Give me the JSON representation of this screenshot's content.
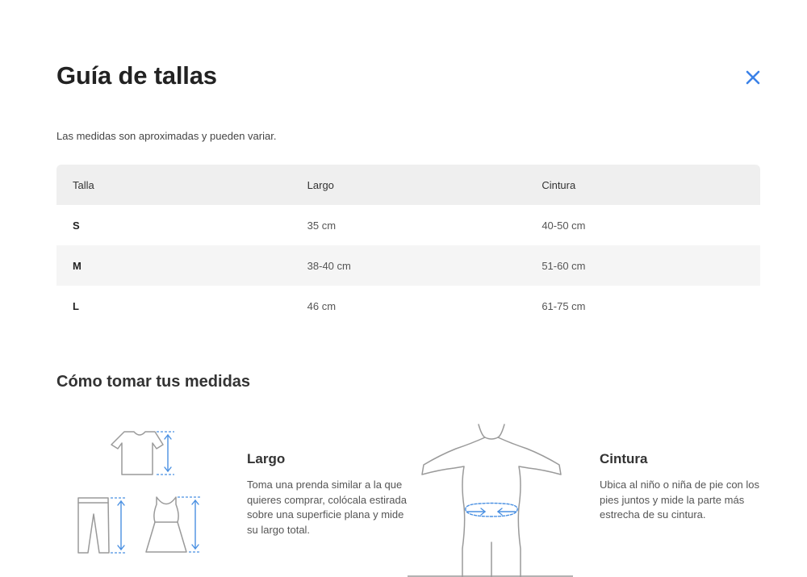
{
  "header": {
    "title": "Guía de tallas",
    "close_icon": "close-icon"
  },
  "intro": "Las medidas son aproximadas y pueden variar.",
  "table": {
    "columns": [
      "Talla",
      "Largo",
      "Cintura"
    ],
    "rows": [
      [
        "S",
        "35 cm",
        "40-50 cm"
      ],
      [
        "M",
        "38-40 cm",
        "51-60 cm"
      ],
      [
        "L",
        "46 cm",
        "61-75 cm"
      ]
    ]
  },
  "howto": {
    "title": "Cómo tomar tus medidas",
    "length": {
      "title": "Largo",
      "text": "Toma una prenda similar a la que quieres comprar, colócala estirada sobre una superficie plana y mide su largo total.",
      "illustration": "garments-length-illustration"
    },
    "waist": {
      "title": "Cintura",
      "text": "Ubica al niño o niña de pie con los pies juntos y mide la parte más estrecha de su cintura.",
      "illustration": "body-waist-illustration"
    }
  },
  "colors": {
    "accent": "#4a90e2",
    "outline": "#9a9a9a",
    "header_row": "#efefef",
    "striped_row": "#f5f5f5"
  }
}
